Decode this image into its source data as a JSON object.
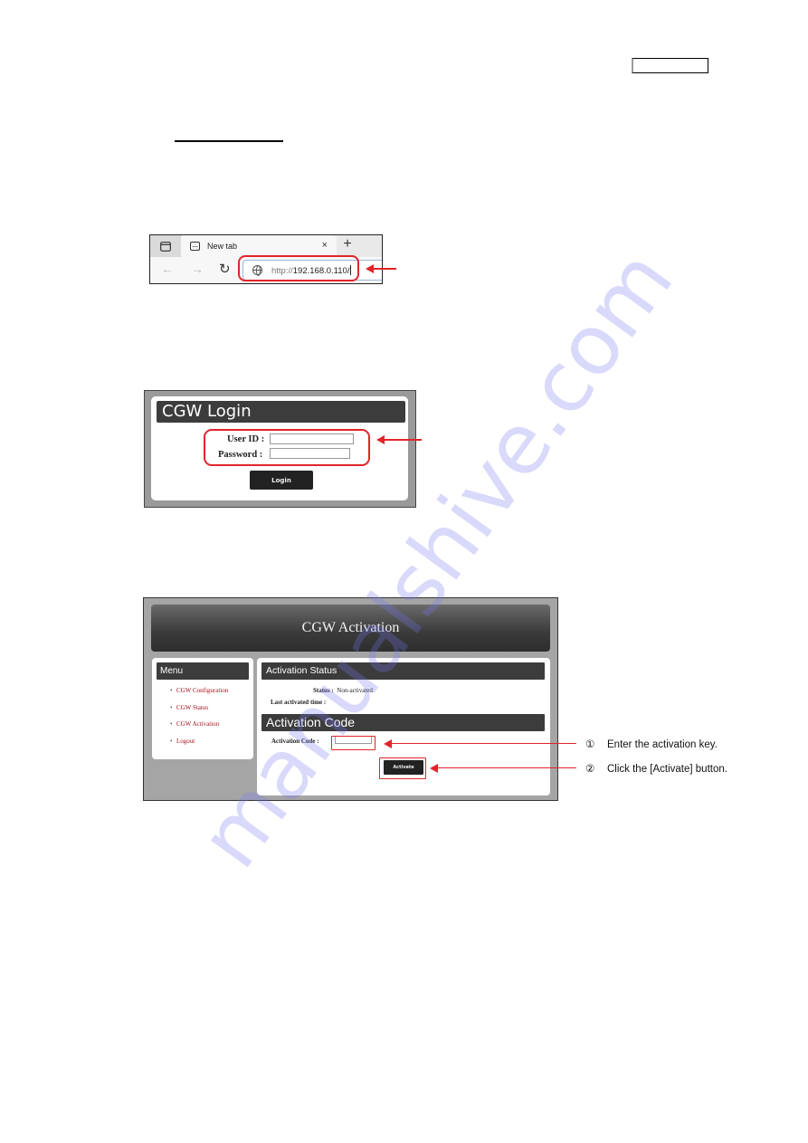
{
  "document": {
    "header_box_text": "",
    "watermark": "manualshive.com"
  },
  "browser": {
    "tab_label": "New tab",
    "tab_close": "×",
    "new_tab": "+",
    "nav_back": "←",
    "nav_forward": "→",
    "nav_reload": "↻",
    "url_scheme": "http://",
    "url_host": "192.168.0.110/"
  },
  "login": {
    "title": "CGW Login",
    "user_id_label": "User ID :",
    "password_label": "Password :",
    "user_id_value": "",
    "password_value": "",
    "login_button": "Login"
  },
  "activation": {
    "title": "CGW Activation",
    "menu": {
      "title": "Menu",
      "items": [
        {
          "label": "CGW Configuration"
        },
        {
          "label": "CGW Status"
        },
        {
          "label": "CGW Activation"
        },
        {
          "label": "Logout"
        }
      ]
    },
    "status_section_title": "Activation Status",
    "status_label": "Status :",
    "status_value": "Non-activated",
    "last_activated_label": "Last activated time :",
    "last_activated_value": "",
    "code_section_title": "Activation Code",
    "code_label": "Activation Code :",
    "code_value": "",
    "activate_button": "Activate"
  },
  "callouts": [
    {
      "number": "①",
      "text": "Enter the activation key."
    },
    {
      "number": "②",
      "text": "Click the [Activate] button."
    }
  ],
  "colors": {
    "annotation_red": "#e1242a",
    "menu_link": "#a5121c",
    "section_header": "#3c3c3c",
    "frame_gray": "#a5a5a5"
  }
}
